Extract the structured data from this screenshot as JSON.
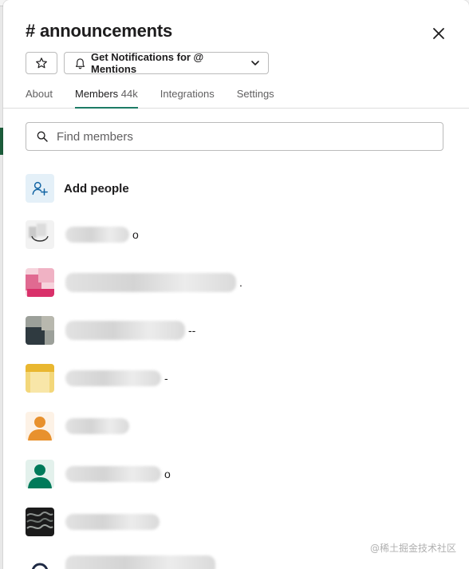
{
  "channel": {
    "title": "# announcements"
  },
  "header": {
    "notification_label": "Get Notifications for @ Mentions"
  },
  "tabs": [
    {
      "label": "About",
      "count": ""
    },
    {
      "label": "Members",
      "count": "44k"
    },
    {
      "label": "Integrations",
      "count": ""
    },
    {
      "label": "Settings",
      "count": ""
    }
  ],
  "search": {
    "placeholder": "Find members",
    "value": ""
  },
  "add_people": {
    "label": "Add people"
  },
  "members": [
    {
      "tail": "o",
      "avatar": "gray-default"
    },
    {
      "tail": ".",
      "avatar": "pink"
    },
    {
      "tail": "--",
      "avatar": "dark-photo"
    },
    {
      "tail": "-",
      "avatar": "yellow"
    },
    {
      "tail": "",
      "avatar": "orange-default"
    },
    {
      "tail": "o",
      "avatar": "green-default"
    },
    {
      "tail": "",
      "avatar": "dark-pattern"
    },
    {
      "tail": "",
      "avatar": "partial"
    }
  ],
  "watermark": "@稀土掘金技术社区",
  "colors": {
    "accent_tab": "#1d7b66",
    "add_icon_bg": "#e4f0f8",
    "orange_avatar": "#e8912d",
    "green_avatar": "#007a5a"
  }
}
